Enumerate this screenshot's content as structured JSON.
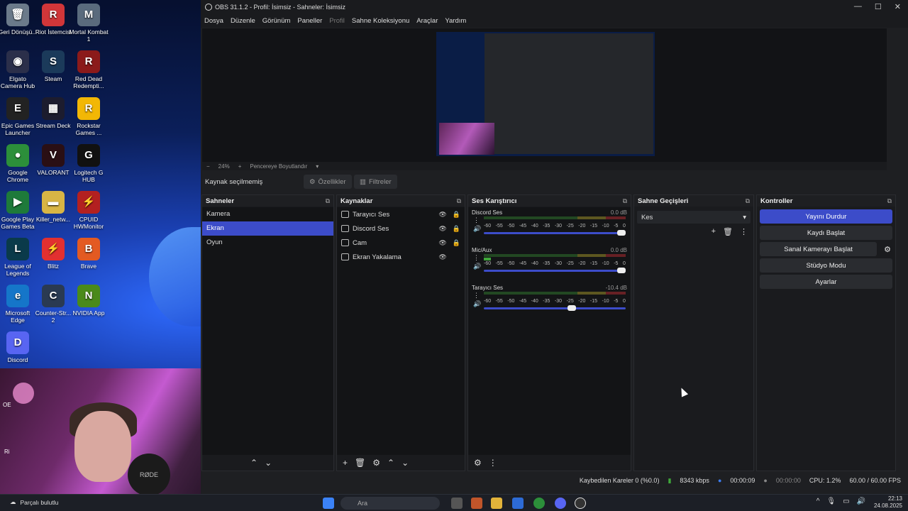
{
  "desktop": {
    "icons": [
      {
        "label": "Geri Dönüşü...",
        "color": "#6b7a8a",
        "glyph": "🗑"
      },
      {
        "label": "Riot İstemcisi",
        "color": "#d13639",
        "glyph": "R"
      },
      {
        "label": "Mortal Kombat 1",
        "color": "#5a6b7d",
        "glyph": "M"
      },
      {
        "label": "Elgato Camera Hub",
        "color": "#2b2f4a",
        "glyph": "◉"
      },
      {
        "label": "Steam",
        "color": "#1b3a5a",
        "glyph": "S"
      },
      {
        "label": "Red Dead Redempti...",
        "color": "#8b1a1a",
        "glyph": "R"
      },
      {
        "label": "Epic Games Launcher",
        "color": "#222",
        "glyph": "E"
      },
      {
        "label": "Stream Deck",
        "color": "#1c1c2e",
        "glyph": "▦"
      },
      {
        "label": "Rockstar Games ...",
        "color": "#f2b705",
        "glyph": "R"
      },
      {
        "label": "Google Chrome",
        "color": "#2c8f3a",
        "glyph": "●"
      },
      {
        "label": "VALORANT",
        "color": "#2a0f14",
        "glyph": "V"
      },
      {
        "label": "Logitech G HUB",
        "color": "#111",
        "glyph": "G"
      },
      {
        "label": "Google Play Games Beta",
        "color": "#1e7a3a",
        "glyph": "▶"
      },
      {
        "label": "Killer_netw...",
        "color": "#d8b545",
        "glyph": "▬"
      },
      {
        "label": "CPUID HWMonitor",
        "color": "#b32020",
        "glyph": "⚡"
      },
      {
        "label": "League of Legends",
        "color": "#0a3a4a",
        "glyph": "L"
      },
      {
        "label": "Blitz",
        "color": "#e23030",
        "glyph": "⚡"
      },
      {
        "label": "Brave",
        "color": "#e35a22",
        "glyph": "B"
      },
      {
        "label": "Microsoft Edge",
        "color": "#1576c9",
        "glyph": "e"
      },
      {
        "label": "Counter-Str... 2",
        "color": "#2a3a52",
        "glyph": "C"
      },
      {
        "label": "NVIDIA App",
        "color": "#4a8a1a",
        "glyph": "N"
      },
      {
        "label": "Discord",
        "color": "#5865f2",
        "glyph": "D"
      }
    ],
    "webcam_mic_label": "RØDE",
    "partial_labels": [
      "OE",
      "Ri"
    ]
  },
  "obs": {
    "title": "OBS 31.1.2 - Profil: İsimsiz - Sahneler: İsimsiz",
    "menu": [
      "Dosya",
      "Düzenle",
      "Görünüm",
      "Paneller",
      "Profil",
      "Sahne Koleksiyonu",
      "Araçlar",
      "Yardım"
    ],
    "zoom": {
      "minus": "−",
      "value": "24%",
      "plus": "+",
      "fit": "Pencereye Boyutlandır"
    },
    "source_bar": {
      "label": "Kaynak seçilmemiş",
      "properties": "Özellikler",
      "filters": "Filtreler"
    },
    "docks": {
      "scenes": {
        "title": "Sahneler",
        "items": [
          {
            "label": "Kamera"
          },
          {
            "label": "Ekran"
          },
          {
            "label": "Oyun"
          }
        ]
      },
      "sources": {
        "title": "Kaynaklar",
        "items": [
          {
            "label": "Tarayıcı Ses"
          },
          {
            "label": "Discord Ses"
          },
          {
            "label": "Cam"
          },
          {
            "label": "Ekran Yakalama"
          }
        ]
      },
      "mixer": {
        "title": "Ses Karıştırıcı",
        "scale": [
          "-60",
          "-55",
          "-50",
          "-45",
          "-40",
          "-35",
          "-30",
          "-25",
          "-20",
          "-15",
          "-10",
          "-5",
          "0"
        ],
        "channels": [
          {
            "name": "Discord Ses",
            "db": "0.0 dB",
            "volume": 1.0,
            "level": 0
          },
          {
            "name": "Mic/Aux",
            "db": "0.0 dB",
            "volume": 1.0,
            "level": 0.05
          },
          {
            "name": "Tarayıcı Ses",
            "db": "-10.4 dB",
            "volume": 0.65,
            "level": 0
          }
        ]
      },
      "transitions": {
        "title": "Sahne Geçişleri",
        "selected": "Kes"
      },
      "controls": {
        "title": "Kontroller",
        "buttons": [
          {
            "label": "Yayını Durdur"
          },
          {
            "label": "Kaydı Başlat"
          },
          {
            "label": "Sanal Kamerayı Başlat"
          },
          {
            "label": "Stüdyo Modu"
          },
          {
            "label": "Ayarlar"
          }
        ]
      }
    },
    "status": {
      "dropped": "Kaybedilen Kareler 0 (%0.0)",
      "bitrate": "8343 kbps",
      "stream_time": "00:00:09",
      "rec_time": "00:00:00",
      "cpu": "CPU: 1.2%",
      "fps": "60.00 / 60.00 FPS"
    }
  },
  "taskbar": {
    "search_placeholder": "Ara",
    "notification": "Parçalı bulutlu",
    "time": "22:13",
    "date": "24.08.2025"
  },
  "colors": {
    "accent": "#3c4cc9",
    "meter_green": "#3fa83a",
    "meter_yellow": "#a89a2a",
    "meter_red": "#a0282e"
  }
}
